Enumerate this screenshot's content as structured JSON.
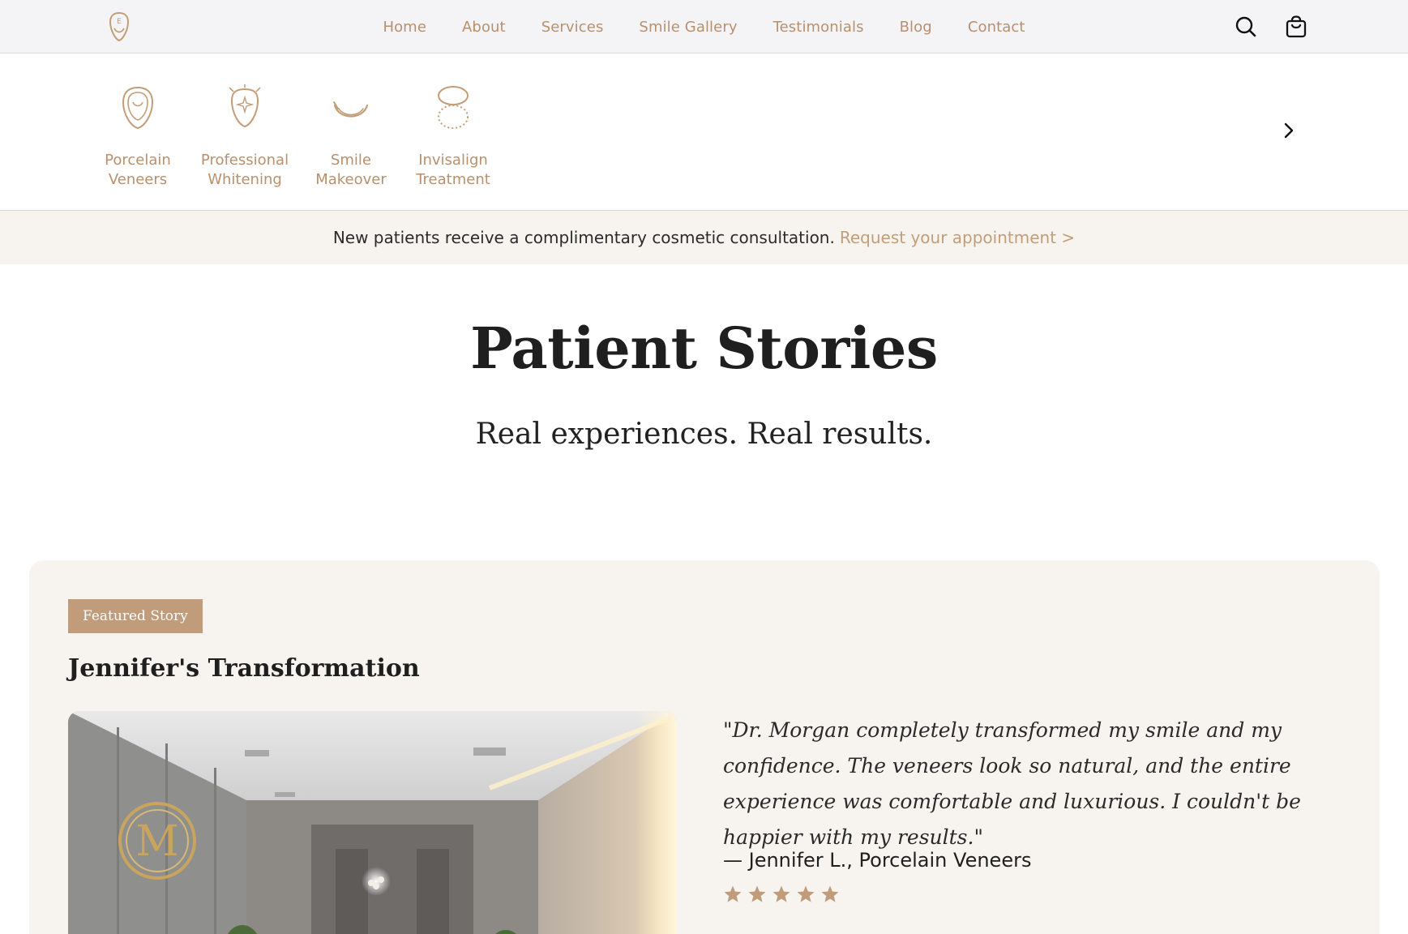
{
  "nav": {
    "logo_letter": "E",
    "links": [
      "Home",
      "About",
      "Services",
      "Smile Gallery",
      "Testimonials",
      "Blog",
      "Contact"
    ],
    "search_icon": "search-icon",
    "cart_icon": "shopping-bag-icon"
  },
  "services": {
    "items": [
      {
        "label": "Porcelain\nVeneers",
        "icon": "veneer-tooth-icon"
      },
      {
        "label": "Professional\nWhitening",
        "icon": "whitening-tooth-icon"
      },
      {
        "label": "Smile\nMakeover",
        "icon": "smile-icon"
      },
      {
        "label": "Invisalign\nTreatment",
        "icon": "aligner-icon"
      }
    ],
    "next_icon": "chevron-right-icon"
  },
  "announcement": {
    "text": "New patients receive a complimentary cosmetic consultation.",
    "link": "Request your appointment >"
  },
  "hero": {
    "title": "Patient Stories",
    "subtitle": "Real experiences. Real results."
  },
  "featured": {
    "badge": "Featured Story",
    "title": "Jennifer's Transformation",
    "quote": "\"Dr. Morgan completely transformed my smile and my confidence. The veneers look so natural, and the entire experience was comfortable and luxurious. I couldn't be happier with my results.\"",
    "author": "— Jennifer L., Porcelain Veneers",
    "rating": 5
  },
  "colors": {
    "accent": "#c09c7b",
    "nav_text": "#b8906e",
    "card_bg": "#f7f3ef",
    "banner_bg": "#f7f4ef"
  }
}
